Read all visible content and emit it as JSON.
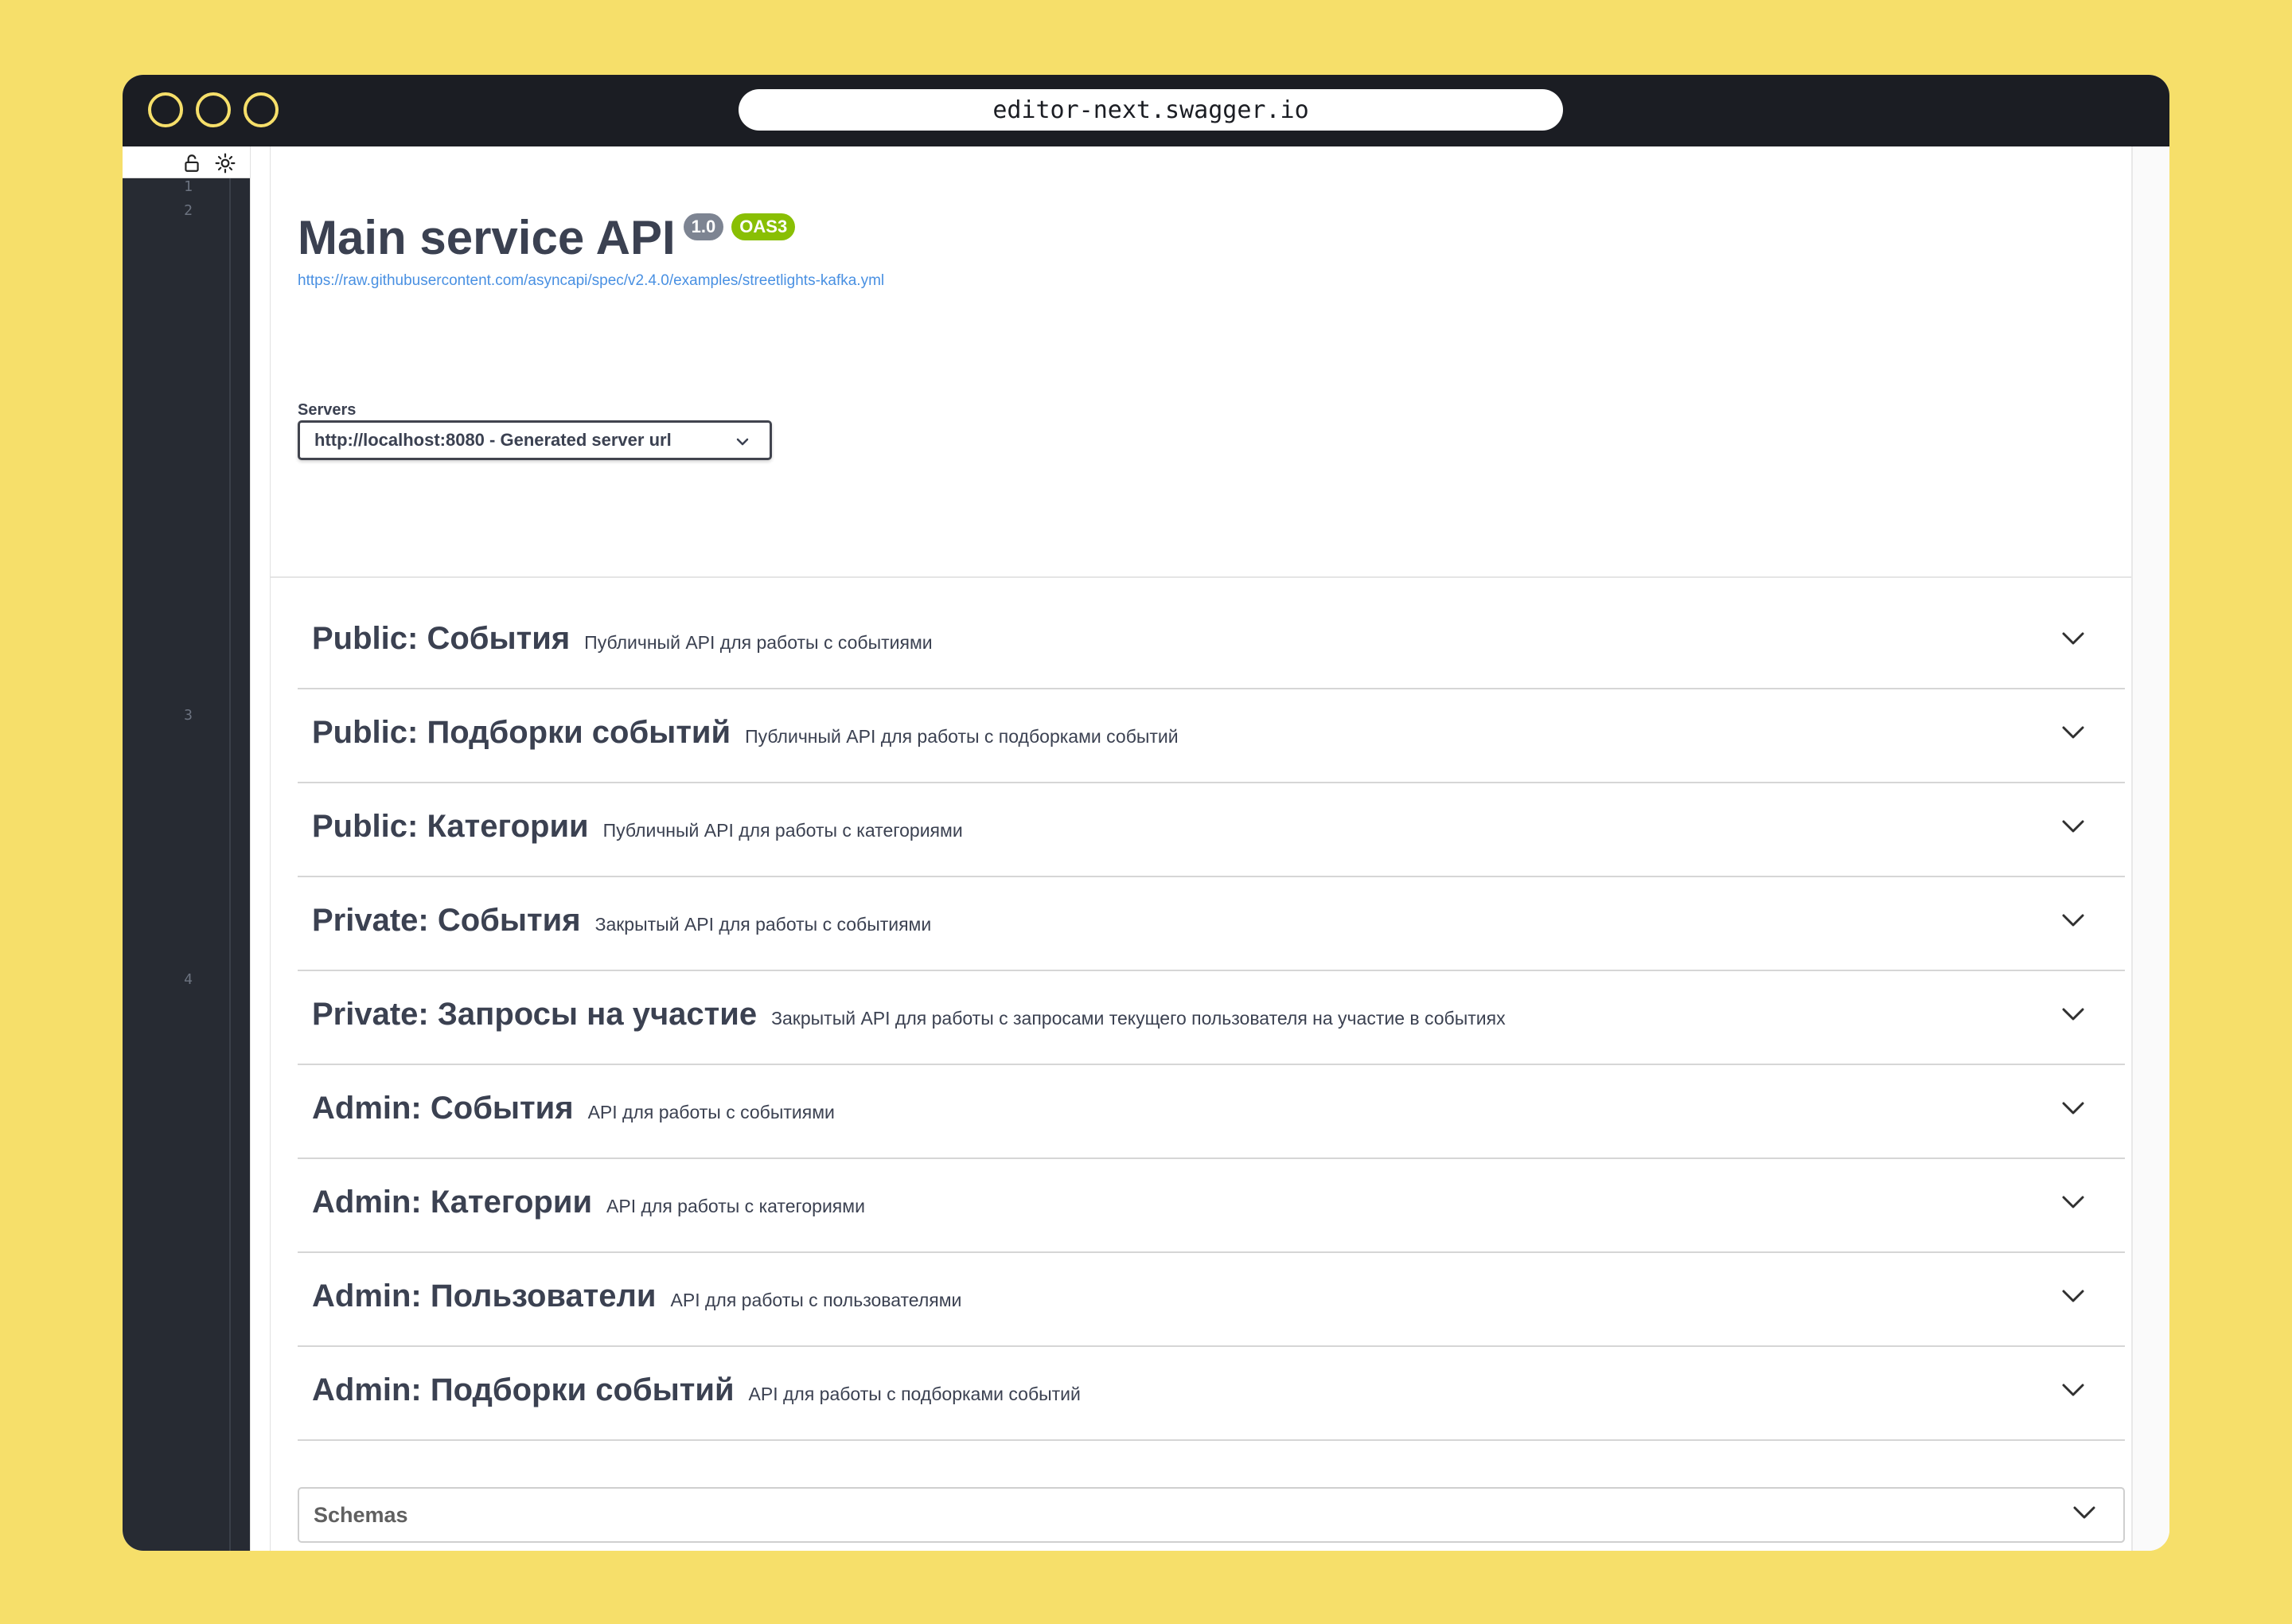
{
  "browser": {
    "url": "editor-next.swagger.io"
  },
  "editor": {
    "line_numbers": [
      "1",
      "2",
      "3",
      "4"
    ]
  },
  "info": {
    "title": "Main service API",
    "version_badge": "1.0",
    "oas_badge": "OAS3",
    "spec_url": "https://raw.githubusercontent.com/asyncapi/spec/v2.4.0/examples/streetlights-kafka.yml"
  },
  "servers": {
    "label": "Servers",
    "selected": "http://localhost:8080 - Generated server url"
  },
  "tags": [
    {
      "name": "Public: События",
      "description": "Публичный API для работы с событиями"
    },
    {
      "name": "Public: Подборки событий",
      "description": "Публичный API для работы с подборками событий"
    },
    {
      "name": "Public: Категории",
      "description": "Публичный API для работы с категориями"
    },
    {
      "name": "Private: События",
      "description": "Закрытый API для работы с событиями"
    },
    {
      "name": "Private: Запросы на участие",
      "description": "Закрытый API для работы с запросами текущего пользователя на участие в событиях"
    },
    {
      "name": "Admin: События",
      "description": "API для работы с событиями"
    },
    {
      "name": "Admin: Категории",
      "description": "API для работы с категориями"
    },
    {
      "name": "Admin: Пользователи",
      "description": "API для работы с пользователями"
    },
    {
      "name": "Admin: Подборки событий",
      "description": "API для работы с подборками событий"
    }
  ],
  "schemas": {
    "label": "Schemas"
  },
  "colors": {
    "background": "#f6df6a",
    "titlebar": "#1b1d23",
    "editor_bg": "#272b33",
    "text": "#3b4151",
    "link": "#4990e2",
    "version_badge": "#7d8492",
    "oas_badge": "#89bf04"
  }
}
